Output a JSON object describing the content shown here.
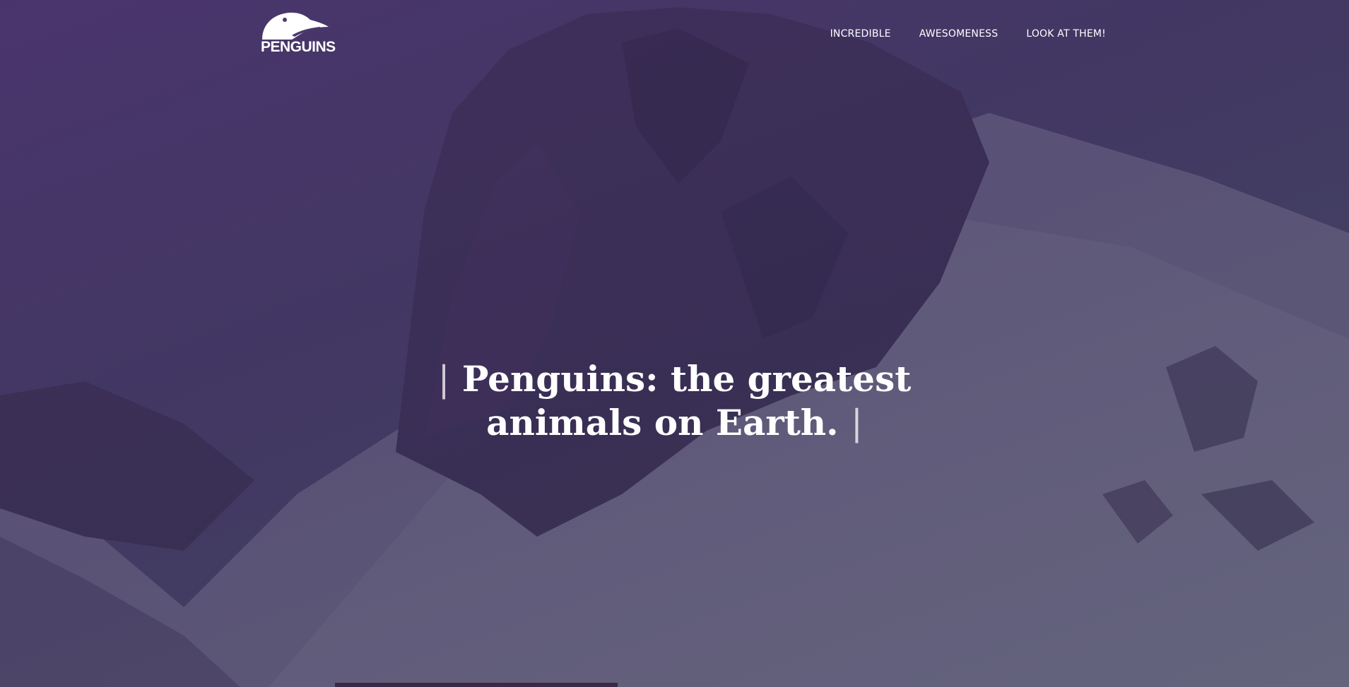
{
  "brand": {
    "name": "PENGUINS",
    "logo_icon": "penguin-head-icon"
  },
  "nav": {
    "items": [
      {
        "label": "INCREDIBLE"
      },
      {
        "label": "AWESOMENESS"
      },
      {
        "label": "LOOK AT THEM!"
      }
    ]
  },
  "hero": {
    "headline_line1": "Penguins: the greatest",
    "headline_line2": "animals on Earth.",
    "cursor_glyph": "|",
    "background": "snowy-mountain-photo",
    "overlay_color": "#4a3a6d"
  }
}
